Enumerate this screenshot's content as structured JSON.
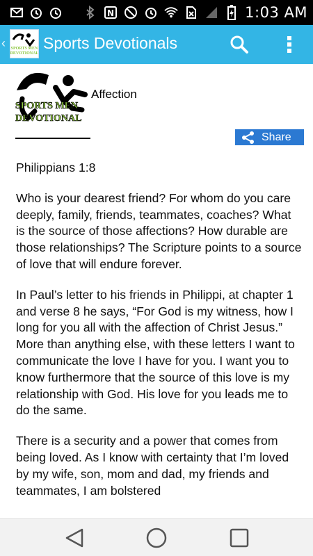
{
  "status_bar": {
    "time": "1:03 AM",
    "left_icons": [
      "email-icon",
      "alarm-clock-icon",
      "alarm-clock-icon"
    ],
    "right_icons": [
      "bluetooth-icon",
      "nfc-icon",
      "mute-icon",
      "alarm-icon",
      "wifi-icon",
      "no-sim-icon",
      "signal-icon",
      "battery-charging-icon"
    ]
  },
  "app_bar": {
    "title": "Sports Devotionals",
    "logo_text": "SPORTS MEN DEVOTIONAL",
    "color": "#33b5e5"
  },
  "devotional": {
    "logo_line1": "SPORTS MEN",
    "logo_line2": "DEVOTIONAL",
    "title": "Affection",
    "share_label": "Share",
    "reference": "Philippians 1:8",
    "paragraphs": [
      "Who is your dearest friend?  For whom do you care deeply, family, friends, teammates, coaches?  What is the source of those affections?  How durable are those relationships?  The Scripture points to a source of love that will endure forever.",
      "In Paul’s letter to his friends in Philippi, at chapter 1 and verse 8 he says, “For God is my witness, how I long for you all with the affection of Christ Jesus.”  More than anything else, with these letters I want to communicate the love I have for you.  I want you to know furthermore that the source of this love is my relationship with God.  His love for you leads me to do the same.",
      "There is a security and a power that comes from being loved.  As I know with certainty that I’m loved by my wife, son, mom and dad, my friends and teammates, I am bolstered"
    ]
  },
  "nav_bar": {
    "buttons": [
      "back-triangle-icon",
      "home-circle-icon",
      "recents-square-icon"
    ]
  }
}
